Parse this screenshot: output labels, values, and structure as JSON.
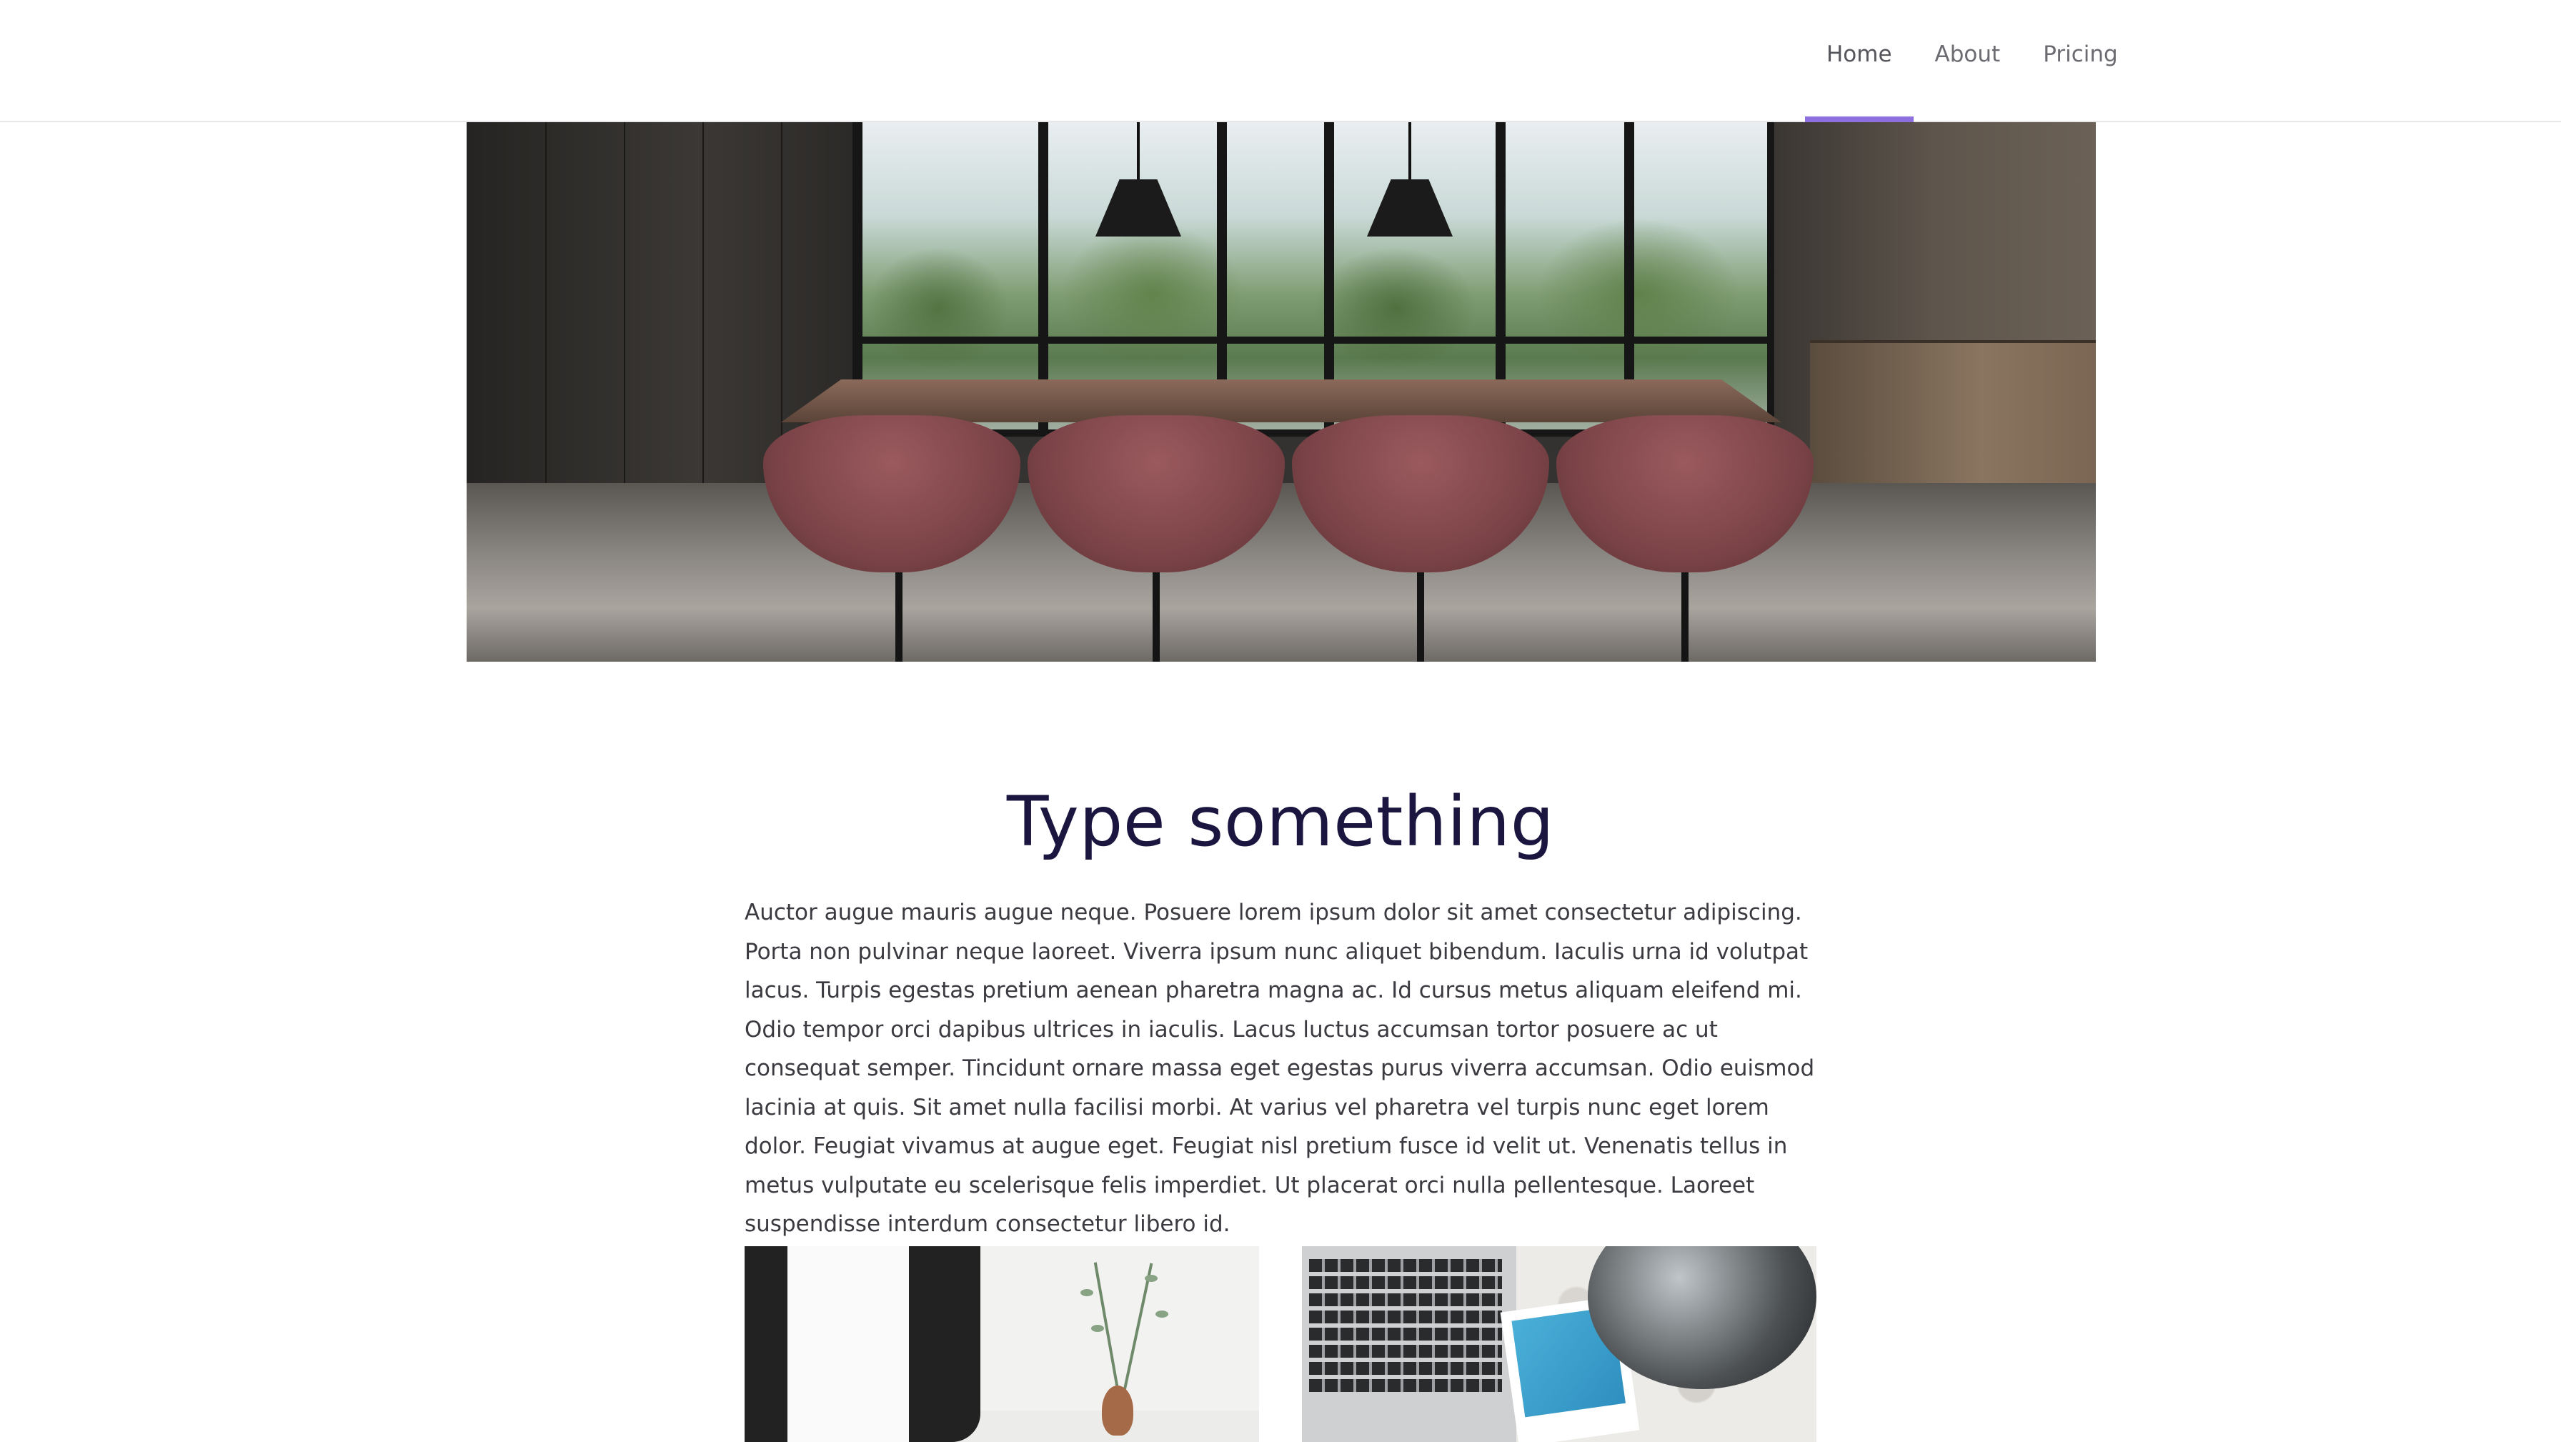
{
  "nav": {
    "items": [
      {
        "label": "Home",
        "active": true
      },
      {
        "label": "About",
        "active": false
      },
      {
        "label": "Pricing",
        "active": false
      }
    ],
    "accent_color": "#8e6fe0"
  },
  "hero": {
    "image_description": "meeting-room-photo"
  },
  "content": {
    "title": "Type something",
    "paragraph": "Auctor augue mauris augue neque. Posuere lorem ipsum dolor sit amet consectetur adipiscing. Porta non pulvinar neque laoreet. Viverra ipsum nunc aliquet bibendum. Iaculis urna id volutpat lacus. Turpis egestas pretium aenean pharetra magna ac. Id cursus metus aliquam eleifend mi. Odio tempor orci dapibus ultrices in iaculis. Lacus luctus accumsan tortor posuere ac ut consequat semper. Tincidunt ornare massa eget egestas purus viverra accumsan. Odio euismod lacinia at quis. Sit amet nulla facilisi morbi. At varius vel pharetra vel turpis nunc eget lorem dolor. Feugiat vivamus at augue eget. Feugiat nisl pretium fusce id velit ut. Venenatis tellus in metus vulputate eu scelerisque felis imperdiet. Ut placerat orci nulla pellentesque. Laoreet suspendisse interdum consectetur libero id."
  },
  "colors": {
    "title": "#1a1640",
    "body_text": "#3a3a40",
    "nav_text": "#6b6b72"
  }
}
